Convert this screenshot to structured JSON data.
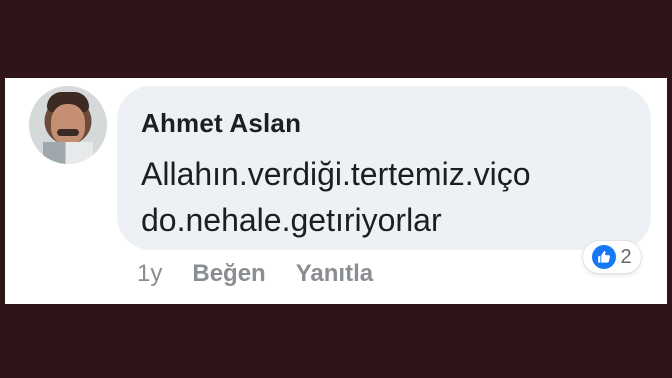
{
  "comment": {
    "author": "Ahmet Aslan",
    "lines": [
      "Allahın.verdiği.tertemiz.viço",
      "do.nehale.getıriyorlar"
    ],
    "time": "1y",
    "like_label": "Beğen",
    "reply_label": "Yanıtla",
    "reaction_count": "2"
  },
  "icons": {
    "reaction": "thumbs-up-icon"
  },
  "colors": {
    "background": "#2f1518",
    "card": "#ffffff",
    "bubble": "#edf0f4",
    "text": "#1c1e21",
    "meta": "#8a8d91",
    "like_blue": "#1877f2"
  }
}
